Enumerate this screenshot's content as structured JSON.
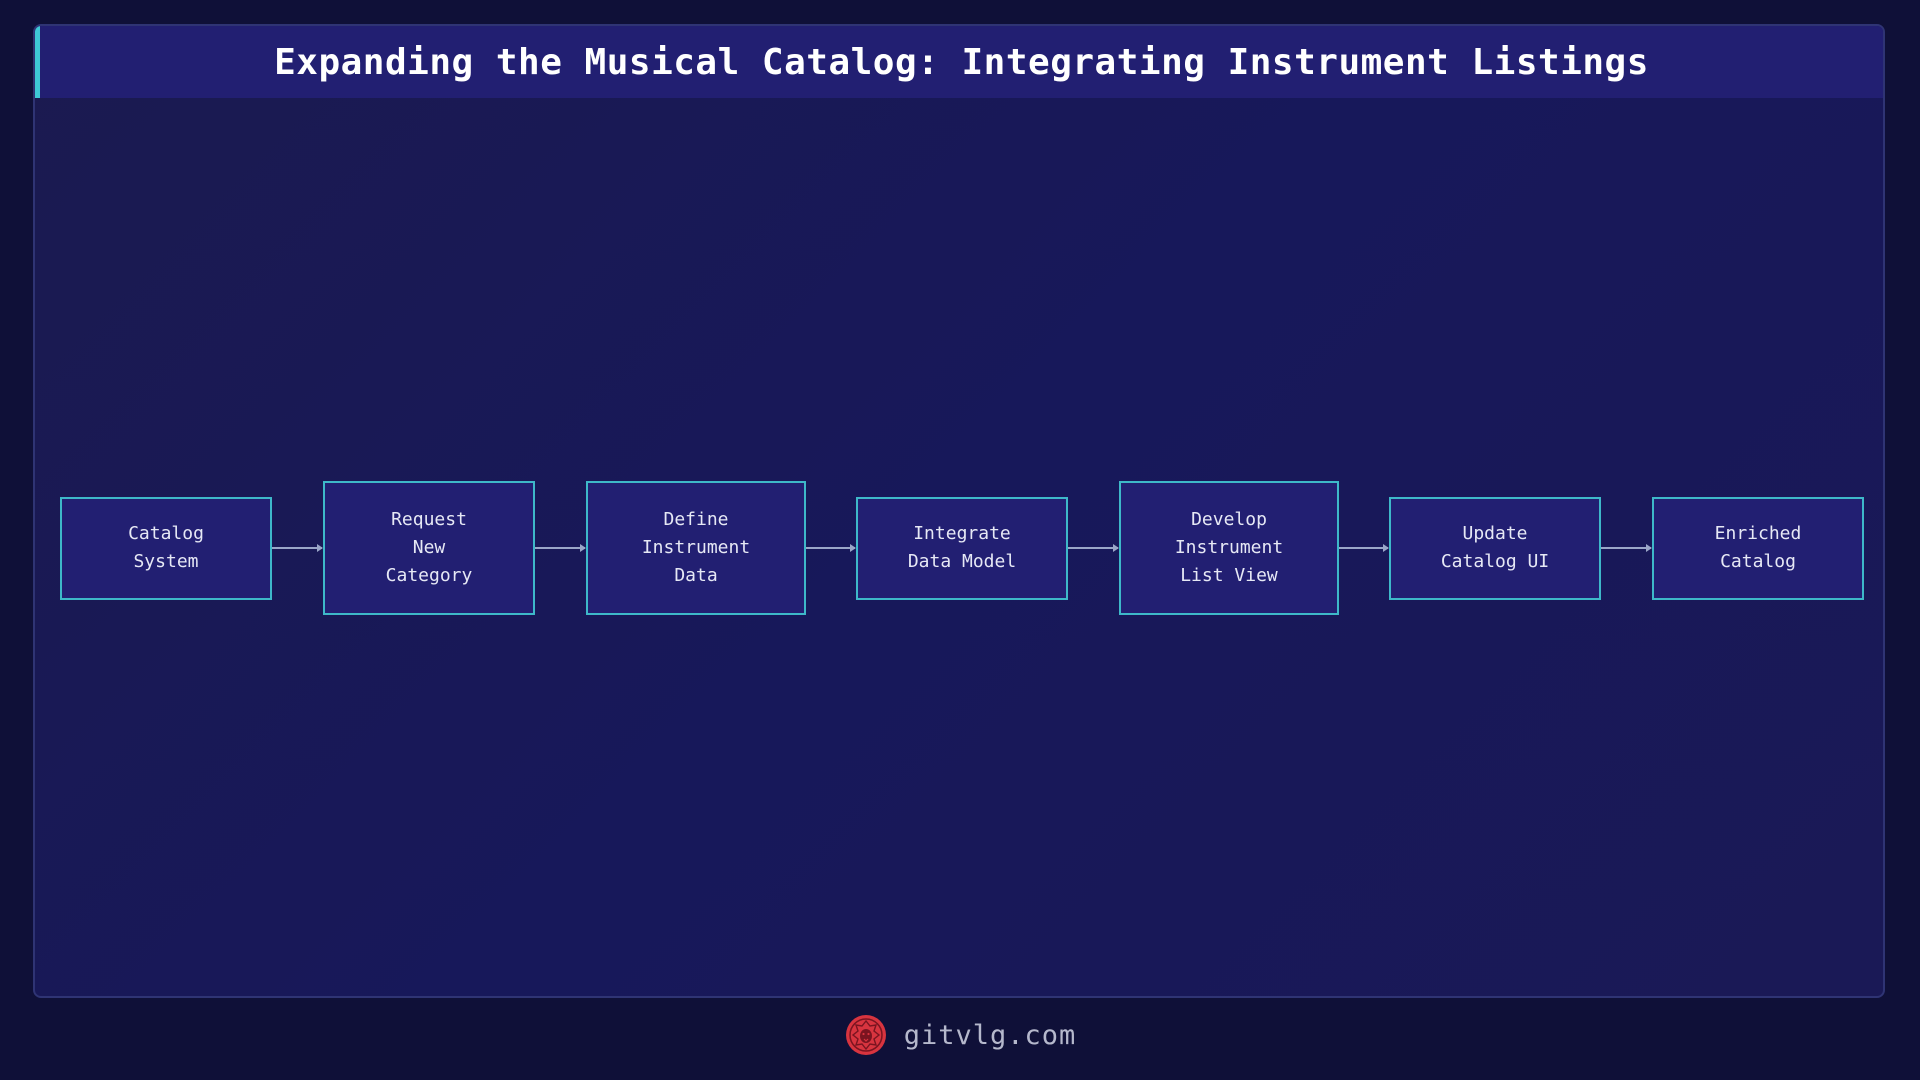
{
  "header": {
    "title": "Expanding the Musical Catalog: Integrating Instrument Listings"
  },
  "flow": {
    "nodes": [
      {
        "id": "catalog-system",
        "label": "Catalog\nSystem"
      },
      {
        "id": "request-new-category",
        "label": "Request\nNew\nCategory"
      },
      {
        "id": "define-instrument-data",
        "label": "Define\nInstrument\nData"
      },
      {
        "id": "integrate-data-model",
        "label": "Integrate\nData Model"
      },
      {
        "id": "develop-instrument-list-view",
        "label": "Develop\nInstrument\nList View"
      },
      {
        "id": "update-catalog-ui",
        "label": "Update\nCatalog UI"
      },
      {
        "id": "enriched-catalog",
        "label": "Enriched\nCatalog"
      }
    ],
    "edges": [
      {
        "from": "catalog-system",
        "to": "request-new-category"
      },
      {
        "from": "request-new-category",
        "to": "define-instrument-data"
      },
      {
        "from": "define-instrument-data",
        "to": "integrate-data-model"
      },
      {
        "from": "integrate-data-model",
        "to": "develop-instrument-list-view"
      },
      {
        "from": "develop-instrument-list-view",
        "to": "update-catalog-ui"
      },
      {
        "from": "update-catalog-ui",
        "to": "enriched-catalog"
      }
    ]
  },
  "footer": {
    "site": "gitvlg.com",
    "logo_icon": "lion-logo-icon"
  },
  "colors": {
    "background": "#0f1038",
    "panel": "#1a1955",
    "title_bar": "#221f72",
    "accent": "#3ec9d6",
    "node_border": "#3eb8c9",
    "connector": "#9aa6c8",
    "logo": "#d8343f"
  }
}
